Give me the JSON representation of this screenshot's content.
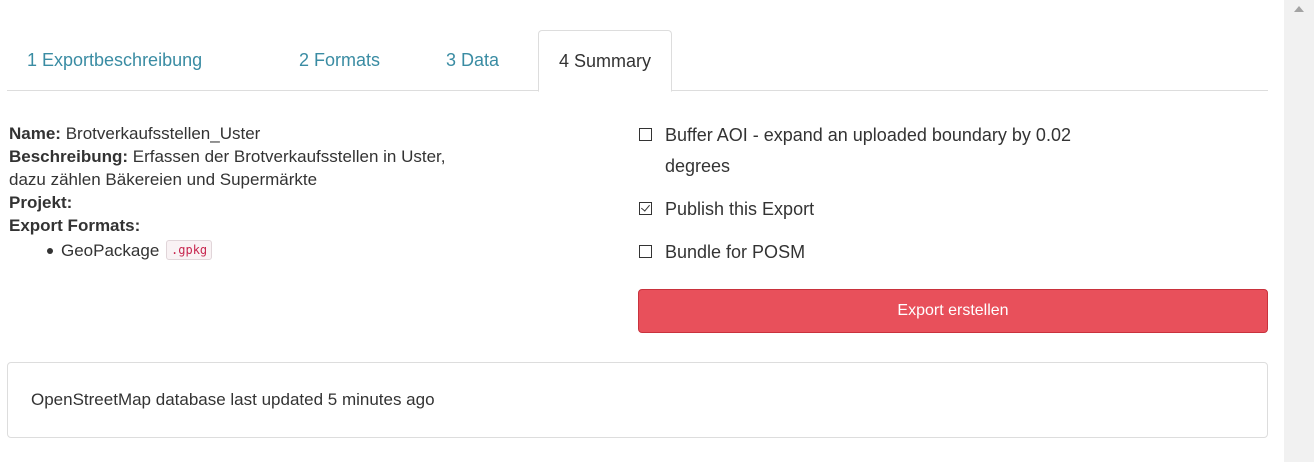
{
  "tabs": [
    {
      "label": "1 Exportbeschreibung",
      "active": false
    },
    {
      "label": "2 Formats",
      "active": false
    },
    {
      "label": "3 Data",
      "active": false
    },
    {
      "label": "4 Summary",
      "active": true
    }
  ],
  "summary": {
    "name_label": "Name:",
    "name_value": " Brotverkaufsstellen_Uster",
    "description_label": "Beschreibung:",
    "description_value_line1": " Erfassen der Brotverkaufsstellen in Uster,",
    "description_value_line2": "dazu zählen Bäkereien und Supermärkte",
    "project_label": "Projekt:",
    "formats_label": "Export Formats:",
    "formats": [
      {
        "name": "GeoPackage",
        "ext": ".gpkg"
      }
    ]
  },
  "options": {
    "buffer_aoi": {
      "label_line1": "Buffer AOI - expand an uploaded boundary by 0.02",
      "label_line2": "degrees",
      "checked": false
    },
    "publish": {
      "label": "Publish this Export",
      "checked": true
    },
    "bundle": {
      "label": "Bundle for POSM",
      "checked": false
    },
    "export_button": "Export erstellen"
  },
  "footer": {
    "db_status": "OpenStreetMap database last updated 5 minutes ago"
  },
  "colors": {
    "tab_link": "#3a8ca3",
    "export_button": "#e8505b",
    "code_text": "#c7254e"
  }
}
